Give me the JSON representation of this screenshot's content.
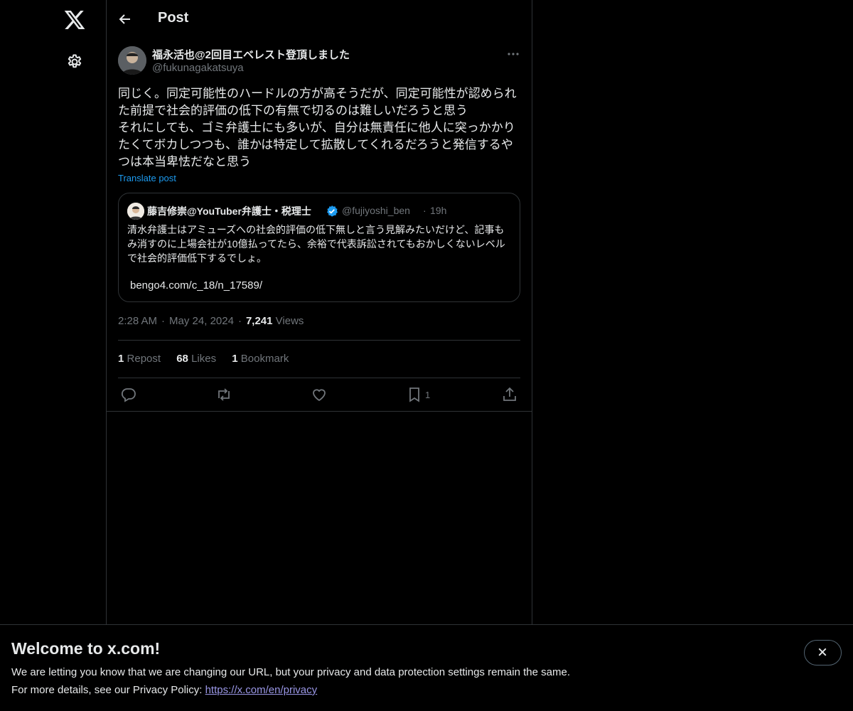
{
  "nav": {
    "logo_icon": "x-logo-icon",
    "settings_icon": "gear-icon"
  },
  "header": {
    "title": "Post",
    "back_icon": "arrow-left-icon"
  },
  "post": {
    "author_name": "福永活也@2回目エベレスト登頂しました",
    "author_handle": "@fukunagakatsuya",
    "text": "同じく。同定可能性のハードルの方が高そうだが、同定可能性が認められた前提で社会的評価の低下の有無で切るのは難しいだろうと思う\nそれにしても、ゴミ弁護士にも多いが、自分は無責任に他人に突っかかりたくてボカしつつも、誰かは特定して拡散してくれるだろうと発信するやつは本当卑怯だなと思う",
    "translate_label": "Translate post",
    "time": "2:28 AM",
    "date": "May 24, 2024",
    "views_count": "7,241",
    "views_label": "Views",
    "reposts_count": "1",
    "reposts_label": "Repost",
    "likes_count": "68",
    "likes_label": "Likes",
    "bookmarks_count": "1",
    "bookmarks_label": "Bookmark",
    "bookmark_action_count": "1"
  },
  "quote": {
    "author_name": "藤吉修崇@YouTuber弁護士・税理士",
    "author_handle": "@fujiyoshi_ben",
    "dot": "·",
    "time": "19h",
    "text": "清水弁護士はアミューズへの社会的評価の低下無しと言う見解みたいだけど、記事もみ消すのに上場会社が10億払ってたら、余裕で代表訴訟されてもおかしくないレベルで社会的評価低下するでしょ。",
    "link": "bengo4.com/c_18/n_17589/"
  },
  "banner": {
    "title": "Welcome to x.com!",
    "line1": "We are letting you know that we are changing our URL, but your privacy and data protection settings remain the same.",
    "line2_prefix": "For more details, see our Privacy Policy: ",
    "link": "https://x.com/en/privacy"
  },
  "colors": {
    "background": "#000000",
    "accent": "#1d9bf0",
    "muted": "#71767b",
    "link": "#9a97e6"
  }
}
